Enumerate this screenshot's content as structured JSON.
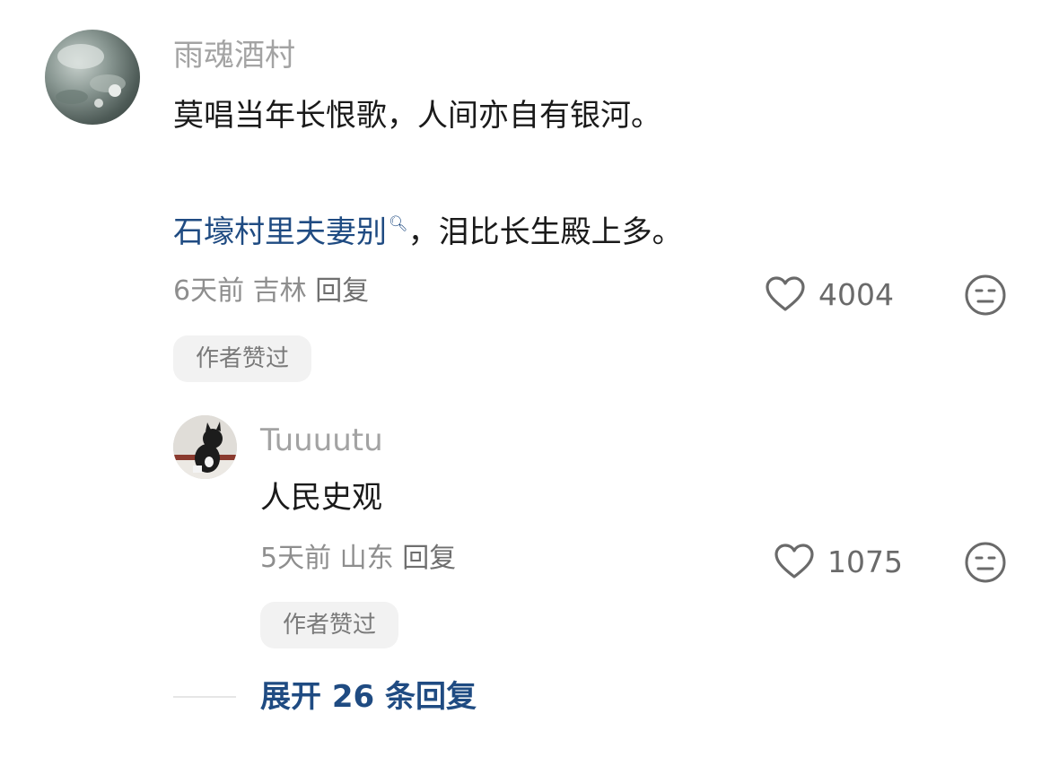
{
  "comment": {
    "username": "雨魂酒村",
    "content_line1": "莫唱当年长恨歌，人间亦自有银河。",
    "content_link": "石壕村里夫妻别",
    "content_line2_rest": "，泪比长生殿上多。",
    "time": "6天前",
    "location": "吉林",
    "reply_label": "回复",
    "like_count": "4004",
    "author_badge": "作者赞过"
  },
  "reply": {
    "username": "Tuuuutu",
    "content": "人民史观",
    "time": "5天前",
    "location": "山东",
    "reply_label": "回复",
    "like_count": "1075",
    "author_badge": "作者赞过"
  },
  "expand": {
    "label": "展开 26 条回复"
  },
  "icons": {
    "like": "heart-outline-icon",
    "dislike": "neutral-face-icon",
    "search": "search-icon"
  },
  "colors": {
    "link": "#1f4b82",
    "username": "#a3a3a3",
    "meta": "#8e8e8e",
    "badge_bg": "#f2f2f2"
  }
}
